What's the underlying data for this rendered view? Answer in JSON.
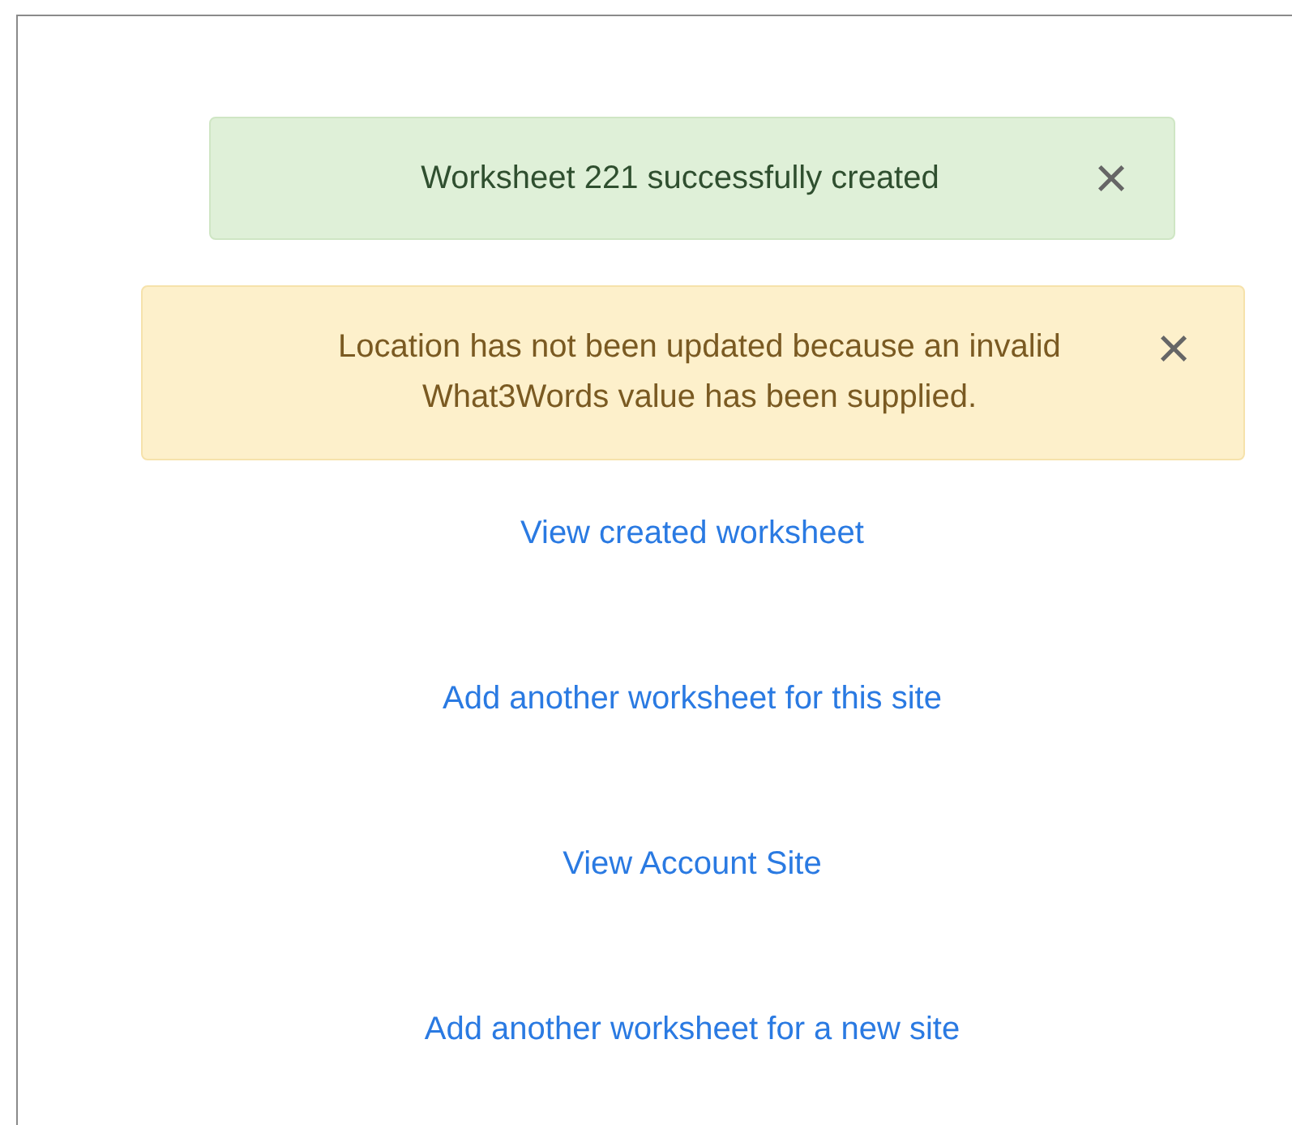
{
  "alerts": [
    {
      "kind": "success",
      "text": "Worksheet 221 successfully created",
      "close": "×"
    },
    {
      "kind": "warning",
      "text": "Location has not been updated because an invalid What3Words value has been supplied.",
      "close": "×"
    }
  ],
  "links": [
    "View created worksheet",
    "Add another worksheet for this site",
    "View Account Site",
    "Add another worksheet for a new site"
  ]
}
